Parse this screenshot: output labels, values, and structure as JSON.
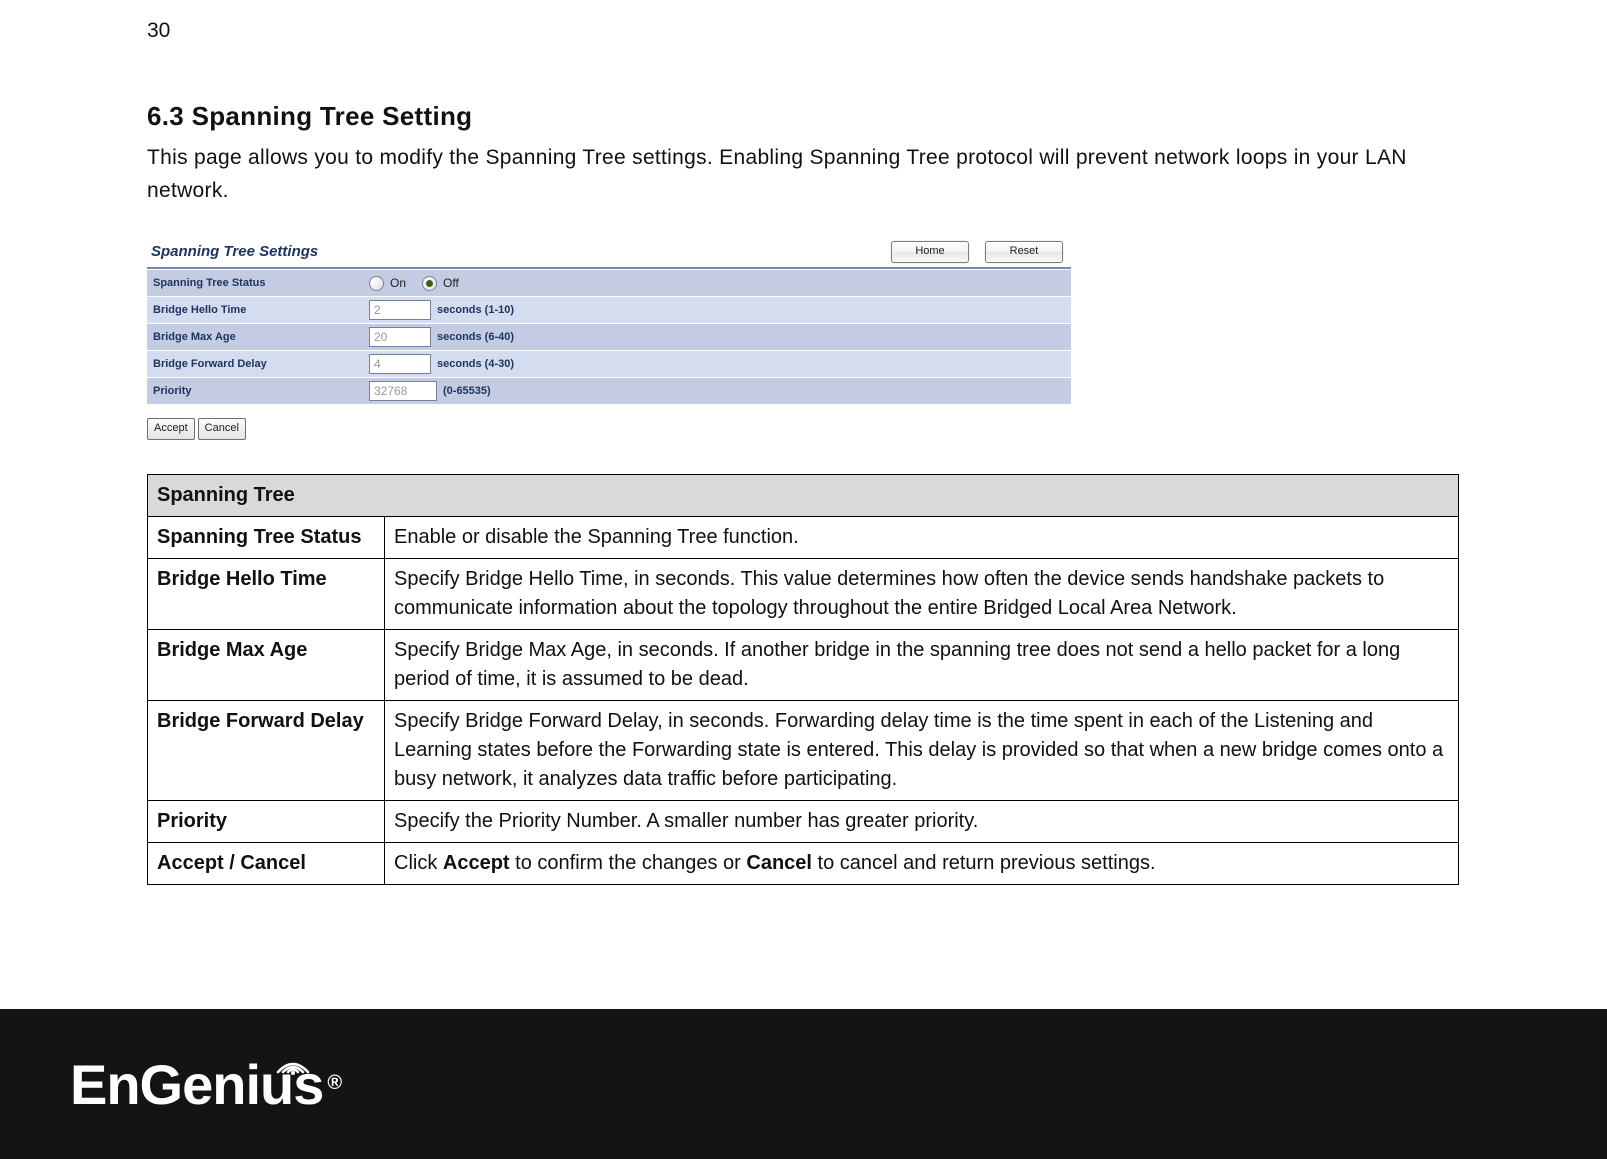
{
  "page_number": "30",
  "heading": "6.3   Spanning Tree Setting",
  "intro": "This page allows you to modify the Spanning Tree settings. Enabling Spanning Tree protocol will prevent network loops in your LAN network.",
  "ui": {
    "title": "Spanning Tree Settings",
    "home_btn": "Home",
    "reset_btn": "Reset",
    "rows": {
      "status_label": "Spanning Tree Status",
      "status_on": "On",
      "status_off": "Off",
      "status_selected": "off",
      "hello_label": "Bridge Hello Time",
      "hello_value": "2",
      "hello_hint": "seconds (1-10)",
      "maxage_label": "Bridge Max Age",
      "maxage_value": "20",
      "maxage_hint": "seconds (6-40)",
      "fwd_label": "Bridge Forward Delay",
      "fwd_value": "4",
      "fwd_hint": "seconds (4-30)",
      "prio_label": "Priority",
      "prio_value": "32768",
      "prio_hint": "(0-65535)"
    },
    "accept_btn": "Accept",
    "cancel_btn": "Cancel"
  },
  "desc": {
    "header": "Spanning Tree",
    "rows": [
      {
        "key": "Spanning Tree Status",
        "val": "Enable or disable the Spanning Tree function."
      },
      {
        "key": "Bridge Hello Time",
        "val": "Specify Bridge Hello Time, in seconds. This value determines how often the device sends handshake packets to communicate information about the topology throughout the entire Bridged Local Area Network."
      },
      {
        "key": "Bridge Max Age",
        "val": "Specify Bridge Max Age, in seconds. If another bridge in the spanning tree does not send a hello packet for a long period of time, it is assumed to be dead."
      },
      {
        "key": "Bridge Forward Delay",
        "val": "Specify Bridge Forward Delay, in seconds. Forwarding delay time is the time spent in each of the Listening and Learning states before the Forwarding state is entered. This delay is provided so that when a new bridge comes onto a busy network, it analyzes data traffic before participating."
      },
      {
        "key": "Priority",
        "val": "Specify the Priority Number. A smaller number has greater priority."
      }
    ],
    "accept_cancel_key": "Accept / Cancel",
    "accept_cancel_pre": "Click ",
    "accept_cancel_b1": "Accept",
    "accept_cancel_mid": " to confirm the changes or ",
    "accept_cancel_b2": "Cancel",
    "accept_cancel_post": " to cancel and return previous settings."
  },
  "footer": {
    "brand": "EnGenius",
    "reg": "®"
  }
}
